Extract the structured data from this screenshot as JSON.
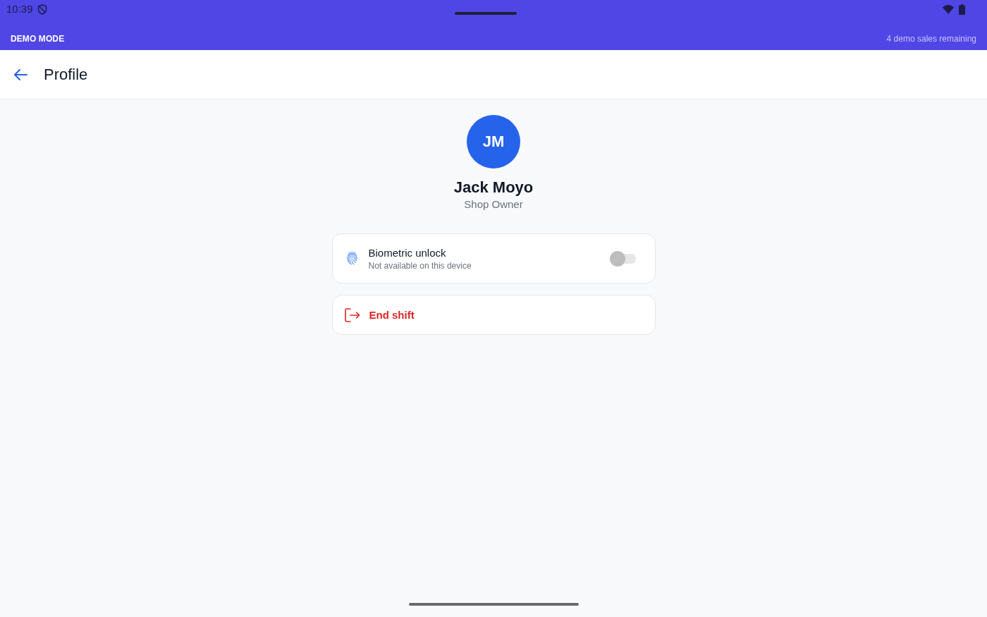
{
  "status_bar": {
    "time": "10:39"
  },
  "demo_banner": {
    "label": "DEMO MODE",
    "remaining": "4 demo sales remaining"
  },
  "app_bar": {
    "title": "Profile"
  },
  "profile": {
    "initials": "JM",
    "name": "Jack Moyo",
    "role": "Shop Owner"
  },
  "settings": [
    {
      "kind": "toggle",
      "title": "Biometric unlock",
      "subtitle": "Not available on this device",
      "on": false,
      "disabled": true
    },
    {
      "kind": "action",
      "label": "End shift"
    }
  ]
}
